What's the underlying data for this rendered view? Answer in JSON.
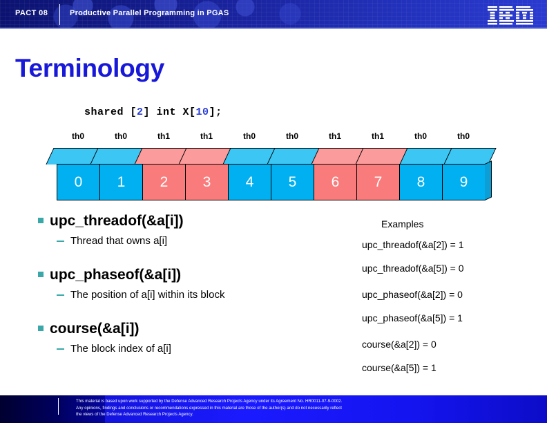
{
  "header": {
    "conference": "PACT 08",
    "subtitle": "Productive Parallel Programming in PGAS",
    "logo_name": "IBM",
    "logo_icon": "ibm-striped-logo"
  },
  "slide": {
    "title": "Terminology"
  },
  "code": {
    "before_block": "shared [",
    "block_size": "2",
    "middle": "] int X[",
    "array_size": "10",
    "after": "];",
    "full": "shared [2] int X[10];"
  },
  "memory_diagram": {
    "thread_labels": [
      "th0",
      "th0",
      "th1",
      "th1",
      "th0",
      "th0",
      "th1",
      "th1",
      "th0",
      "th0"
    ],
    "cell_indices": [
      "0",
      "1",
      "2",
      "3",
      "4",
      "5",
      "6",
      "7",
      "8",
      "9"
    ],
    "cell_owners": [
      "th0",
      "th0",
      "th1",
      "th1",
      "th0",
      "th0",
      "th1",
      "th1",
      "th0",
      "th0"
    ],
    "colors": {
      "th0_front": "#00b0f0",
      "th0_top": "#3cc6f4",
      "th1_front": "#fa7b7b",
      "th1_top": "#fb9b9b",
      "side": "#0d9ed6"
    }
  },
  "bullets": [
    {
      "title": "upc_threadof(&a[i])",
      "sub": "Thread that owns a[i]"
    },
    {
      "title": "upc_phaseof(&a[i])",
      "sub": "The position of a[i] within its block"
    },
    {
      "title": "course(&a[i])",
      "sub": "The block index of a[i]"
    }
  ],
  "examples": {
    "heading": "Examples",
    "groups": [
      {
        "lines": [
          "upc_threadof(&a[2]) = 1",
          "upc_threadof(&a[5]) = 0"
        ]
      },
      {
        "lines": [
          "upc_phaseof(&a[2]) = 0",
          "upc_phaseof(&a[5]) = 1"
        ]
      },
      {
        "lines": [
          "course(&a[2]) = 0",
          "course(&a[5]) = 1"
        ]
      }
    ]
  },
  "footer": {
    "line1": "This material is based upon work supported by the Defense Advanced Research Projects Agency under its Agreement No. HR0011-07-9-0002.",
    "line2": "Any opinions, findings and conclusions or recommendations expressed in this material are those of the  author(s) and do not necessarily reflect",
    "line3": "the views of the Defense Advanced Research Projects Agency."
  },
  "theme": {
    "title_blue": "#1818d8",
    "bullet_teal": "#3aa8a8",
    "header_blue": "#1a24a0",
    "footer_blue": "#1a1aff"
  }
}
